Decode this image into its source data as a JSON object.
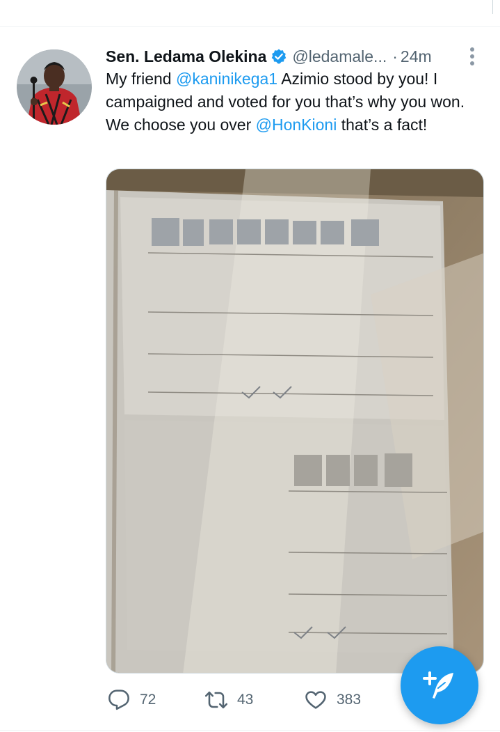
{
  "tweet": {
    "author_name": "Sen. Ledama Olekina",
    "handle": "@ledamale...",
    "separator": "·",
    "time": "24m",
    "text_parts": {
      "p1": "My friend ",
      "m1": "@kaninikega1",
      "p2": " Azimio stood by you! I campaigned and voted for you that’s why you won. We choose you over ",
      "m2": "@HonKioni",
      "p3": " that’s a fact!"
    }
  },
  "actions": {
    "reply_count": "72",
    "retweet_count": "43",
    "like_count": "383"
  },
  "colors": {
    "accent": "#1d9bf0",
    "text": "#0f1419",
    "secondary_text": "#536471"
  },
  "icons": {
    "verified": "verified-badge-icon",
    "more": "more-vertical-icon",
    "reply": "reply-icon",
    "retweet": "retweet-icon",
    "like": "heart-icon",
    "compose": "compose-tweet-icon"
  }
}
